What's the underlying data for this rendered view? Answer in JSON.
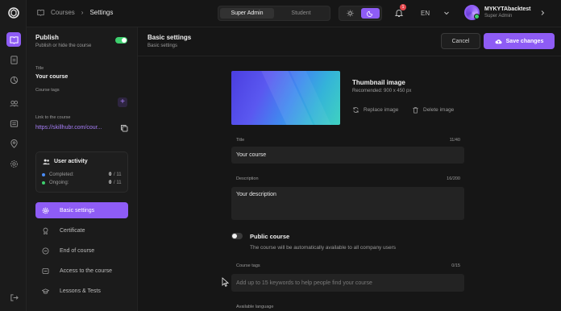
{
  "topbar": {
    "breadcrumb": [
      "Courses",
      "Settings"
    ],
    "role_tabs": [
      {
        "label": "Super Admin",
        "active": true
      },
      {
        "label": "Student",
        "active": false
      }
    ],
    "notifications_count": "1",
    "language": "EN",
    "user": {
      "name": "MYKYTAbacktest",
      "role": "Super Admin"
    }
  },
  "rail": {
    "items": [
      "courses-icon",
      "document-icon",
      "analytics-icon",
      "users-icon",
      "news-icon",
      "location-icon",
      "settings-icon"
    ],
    "logout": "logout-icon",
    "accent": "#8e5cf5"
  },
  "course_sidebar": {
    "publish": {
      "title": "Publish",
      "subtitle": "Publish or hide the course",
      "enabled": true
    },
    "title_label": "Title",
    "title_value": "Your course",
    "tags_label": "Course tags",
    "link_label": "Link to the course",
    "link_value": "https://skillhubr.com/cour...",
    "activity": {
      "title": "User activity",
      "rows": [
        {
          "label": "Completed:",
          "value": "0",
          "total": "/ 11",
          "color": "#4a8cf7"
        },
        {
          "label": "Ongoing:",
          "value": "0",
          "total": "/ 11",
          "color": "#3ecf6e"
        }
      ]
    },
    "nav": [
      {
        "label": "Basic settings",
        "icon": "gear-icon",
        "active": true
      },
      {
        "label": "Certificate",
        "icon": "certificate-icon",
        "active": false
      },
      {
        "label": "End of course",
        "icon": "end-icon",
        "active": false
      },
      {
        "label": "Access to the course",
        "icon": "access-icon",
        "active": false
      },
      {
        "label": "Lessons & Tests",
        "icon": "graduation-icon",
        "active": false
      }
    ]
  },
  "main": {
    "title": "Basic settings",
    "subtitle": "Basic settings",
    "cancel_label": "Cancel",
    "save_label": "Save changes",
    "thumbnail": {
      "title": "Thumbnail image",
      "recommended": "Recomended: 900 x 450 px",
      "replace_label": "Replace image",
      "delete_label": "Delete image"
    },
    "form": {
      "title_label": "Title",
      "title_count": "11/40",
      "title_value": "Your course",
      "description_label": "Description",
      "description_count": "16/200",
      "description_value": "Your description",
      "public": {
        "title": "Public course",
        "subtitle": "The course will be automatically available to all company users",
        "enabled": false
      },
      "tags_label": "Course tags",
      "tags_count": "0/15",
      "tags_placeholder": "Add up to 15 keywords to help people find your course",
      "language_label": "Available language"
    }
  }
}
